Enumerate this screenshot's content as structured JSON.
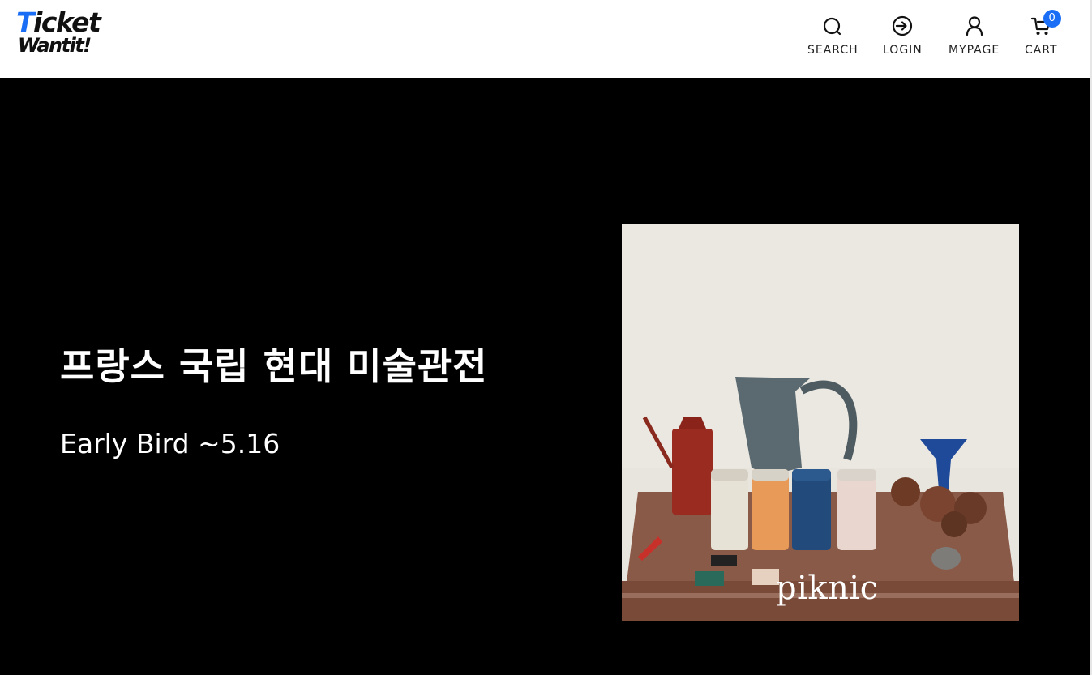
{
  "header": {
    "logo": {
      "line1": "Ticket",
      "line2": "Wantit!"
    },
    "nav": [
      {
        "label": "SEARCH",
        "icon": "search-icon"
      },
      {
        "label": "LOGIN",
        "icon": "login-icon"
      },
      {
        "label": "MYPAGE",
        "icon": "user-icon"
      },
      {
        "label": "CART",
        "icon": "cart-icon",
        "badge": "0"
      }
    ]
  },
  "hero": {
    "title": "프랑스 국립 현대 미술관전",
    "subtitle": "Early Bird ~5.16",
    "poster": {
      "brand": "piknic"
    }
  },
  "colors": {
    "accent": "#1a6ef5",
    "hero_bg": "#000000"
  }
}
